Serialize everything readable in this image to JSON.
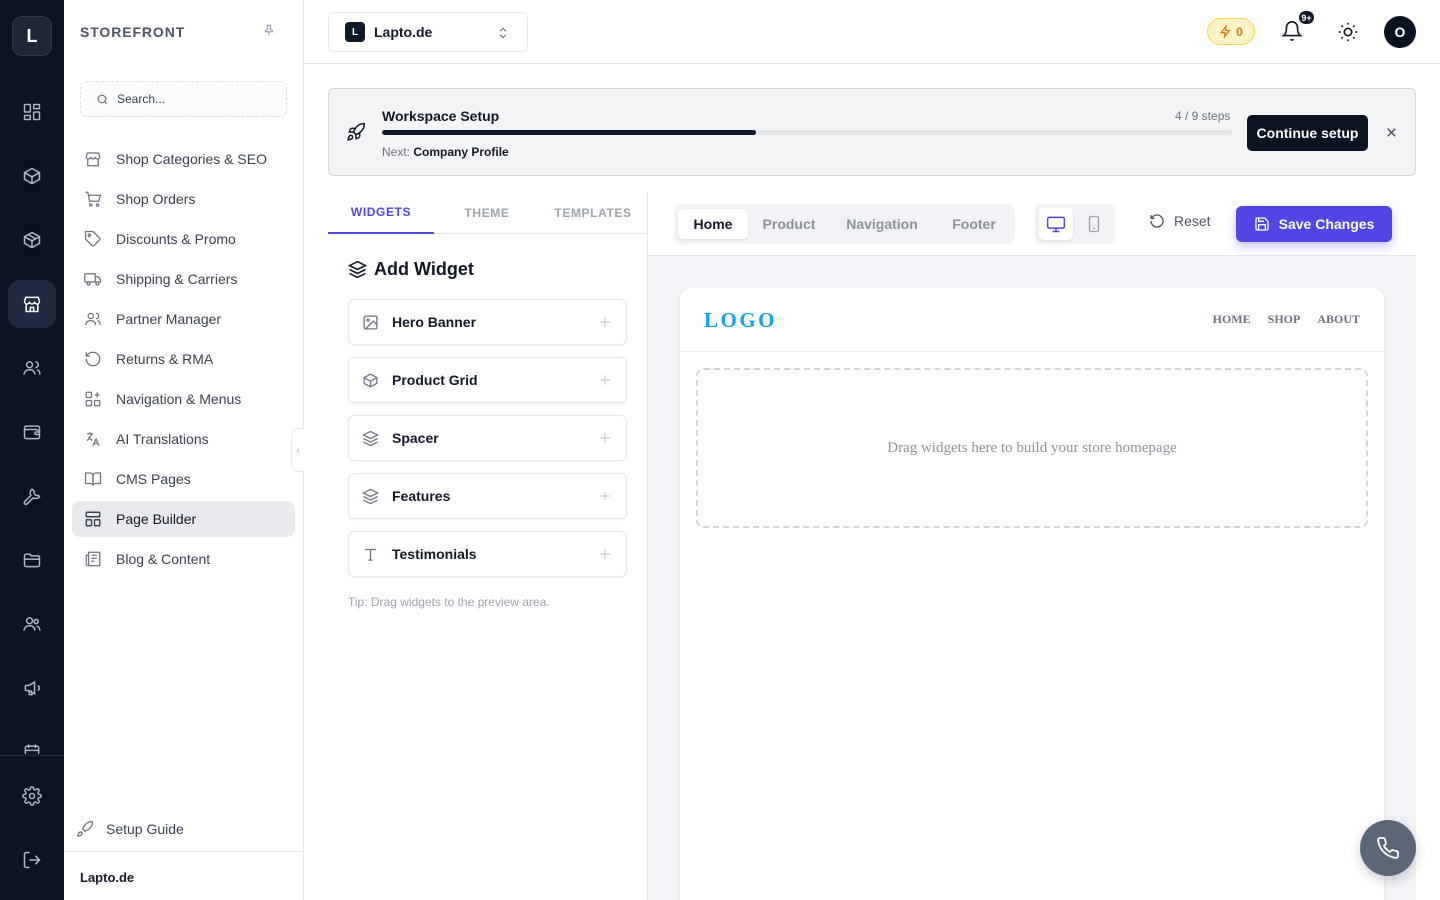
{
  "rail": {
    "logo_letter": "L",
    "items": [
      {
        "icon": "dashboard-icon"
      },
      {
        "icon": "box-icon"
      },
      {
        "icon": "package-icon"
      },
      {
        "icon": "store-icon",
        "active": true
      },
      {
        "icon": "users-icon"
      },
      {
        "icon": "wallet-icon"
      },
      {
        "icon": "wrench-icon"
      },
      {
        "icon": "folder-icon"
      },
      {
        "icon": "team-icon"
      },
      {
        "icon": "megaphone-icon"
      }
    ],
    "bottom": [
      {
        "icon": "settings-icon"
      },
      {
        "icon": "logout-icon"
      }
    ]
  },
  "sidebar": {
    "title": "STOREFRONT",
    "search_placeholder": "Search...",
    "items": [
      {
        "label": "Shop Categories & SEO",
        "icon": "store-icon"
      },
      {
        "label": "Shop Orders",
        "icon": "cart-icon"
      },
      {
        "label": "Discounts & Promo",
        "icon": "tag-icon"
      },
      {
        "label": "Shipping & Carriers",
        "icon": "truck-icon"
      },
      {
        "label": "Partner Manager",
        "icon": "users-icon"
      },
      {
        "label": "Returns & RMA",
        "icon": "rotate-icon"
      },
      {
        "label": "Navigation & Menus",
        "icon": "grid-plus-icon"
      },
      {
        "label": "AI Translations",
        "icon": "translate-icon"
      },
      {
        "label": "CMS Pages",
        "icon": "book-icon"
      },
      {
        "label": "Page Builder",
        "icon": "layout-icon",
        "active": true
      },
      {
        "label": "Blog & Content",
        "icon": "newspaper-icon"
      }
    ],
    "setup_guide": "Setup Guide",
    "footer_store": "Lapto.de"
  },
  "topbar": {
    "store_badge": "L",
    "store_name": "Lapto.de",
    "credits": "0",
    "notifications_badge": "9+",
    "avatar_letter": "O"
  },
  "setup": {
    "title": "Workspace Setup",
    "steps_text": "4 / 9 steps",
    "progress_fraction": 0.44,
    "next_label": "Next:",
    "next_value": "Company Profile",
    "button": "Continue setup"
  },
  "widget_panel": {
    "tabs": [
      "WIDGETS",
      "THEME",
      "TEMPLATES"
    ],
    "active_tab": 0,
    "heading": "Add Widget",
    "widgets": [
      {
        "label": "Hero Banner",
        "icon": "image-icon"
      },
      {
        "label": "Product Grid",
        "icon": "box-icon"
      },
      {
        "label": "Spacer",
        "icon": "layers-icon"
      },
      {
        "label": "Features",
        "icon": "layers-icon"
      },
      {
        "label": "Testimonials",
        "icon": "text-icon"
      }
    ],
    "tip": "Tip: Drag widgets to the preview area."
  },
  "preview": {
    "page_tabs": [
      "Home",
      "Product",
      "Navigation",
      "Footer"
    ],
    "active_page_tab": 0,
    "device": "desktop",
    "reset_label": "Reset",
    "save_label": "Save Changes",
    "page_logo": "LOGO",
    "page_nav": [
      "HOME",
      "SHOP",
      "ABOUT"
    ],
    "dropzone_text": "Drag widgets here to build your store homepage"
  },
  "colors": {
    "rail_bg": "#0b1221",
    "accent": "#4f46e5",
    "logo_blue": "#0ea5e9",
    "credit_amber": "#d97706"
  }
}
